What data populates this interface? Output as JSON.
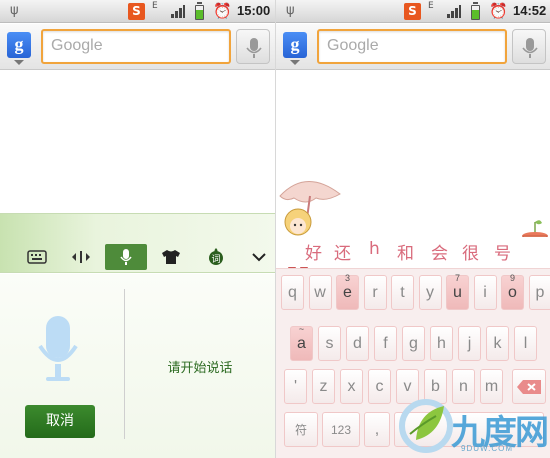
{
  "screens": [
    {
      "status": {
        "time": "15:00",
        "network": "E"
      },
      "search": {
        "placeholder": "Google"
      }
    },
    {
      "status": {
        "time": "14:52",
        "network": "E"
      },
      "search": {
        "placeholder": "Google"
      }
    }
  ],
  "voice_panel": {
    "toolbar": [
      "keyboard-icon",
      "cursor-move-icon",
      "microphone-icon",
      "skin-shirt-icon",
      "vocabulary-icon",
      "chevron-down-icon"
    ],
    "active_tool": "microphone-icon",
    "prompt": "请开始说话",
    "cancel_label": "取消"
  },
  "keyboard": {
    "candidates": [
      "好",
      "还",
      "h",
      "和",
      "会",
      "很",
      "号"
    ],
    "row1": [
      {
        "key": "q",
        "hint": ""
      },
      {
        "key": "w",
        "hint": ""
      },
      {
        "key": "e",
        "hint": "3"
      },
      {
        "key": "r",
        "hint": ""
      },
      {
        "key": "t",
        "hint": ""
      },
      {
        "key": "y",
        "hint": ""
      },
      {
        "key": "u",
        "hint": "7"
      },
      {
        "key": "i",
        "hint": ""
      },
      {
        "key": "o",
        "hint": "9"
      },
      {
        "key": "p",
        "hint": ""
      }
    ],
    "pressed_row1": [
      "e",
      "u",
      "o"
    ],
    "row2": [
      {
        "key": "a",
        "hint": "~"
      },
      {
        "key": "s",
        "hint": ""
      },
      {
        "key": "d",
        "hint": ""
      },
      {
        "key": "f",
        "hint": ""
      },
      {
        "key": "g",
        "hint": ""
      },
      {
        "key": "h",
        "hint": ""
      },
      {
        "key": "j",
        "hint": ""
      },
      {
        "key": "k",
        "hint": ""
      },
      {
        "key": "l",
        "hint": ""
      }
    ],
    "row3": [
      "'",
      "z",
      "x",
      "c",
      "v",
      "b",
      "n",
      "m"
    ],
    "row4": [
      "符",
      "123",
      ","
    ],
    "backspace_icon": "backspace-icon"
  },
  "watermark": {
    "text": "九度网",
    "sub": "9DUW.COM"
  },
  "colors": {
    "search_border": "#f1a43c",
    "voice_green": "#246b1a",
    "keyboard_pink": "#d96b7c"
  }
}
